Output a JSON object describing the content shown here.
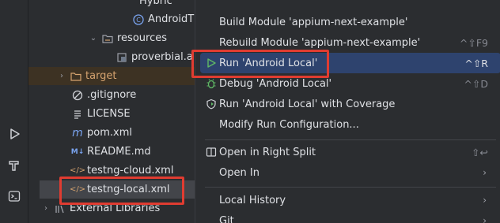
{
  "tree": {
    "partial_top": "Hybric",
    "android_class": "AndroidT",
    "resources": "resources",
    "proverbial": "proverbial.a",
    "target": "target",
    "gitignore": ".gitignore",
    "license": "LICENSE",
    "pom": "pom.xml",
    "readme": "README.md",
    "testng_cloud": "testng-cloud.xml",
    "testng_local": "testng-local.xml",
    "external_libraries": "External Libraries"
  },
  "menu": {
    "build_module": "Build Module 'appium-next-example'",
    "rebuild_module": "Rebuild Module 'appium-next-example'",
    "rebuild_shortcut": "^⇧F9",
    "run_local": "Run 'Android Local'",
    "run_shortcut": "^⇧R",
    "debug_local": "Debug 'Android Local'",
    "debug_shortcut": "^⇧D",
    "run_coverage": "Run 'Android Local' with Coverage",
    "modify_run": "Modify Run Configuration...",
    "open_right_split": "Open in Right Split",
    "open_right_split_shortcut": "⇧↩",
    "open_in": "Open In",
    "local_history": "Local History",
    "git": "Git"
  },
  "colors": {
    "menu_active": "#2e436e",
    "annotation_red": "#e03c31",
    "folder_orange": "#d5a36f"
  }
}
